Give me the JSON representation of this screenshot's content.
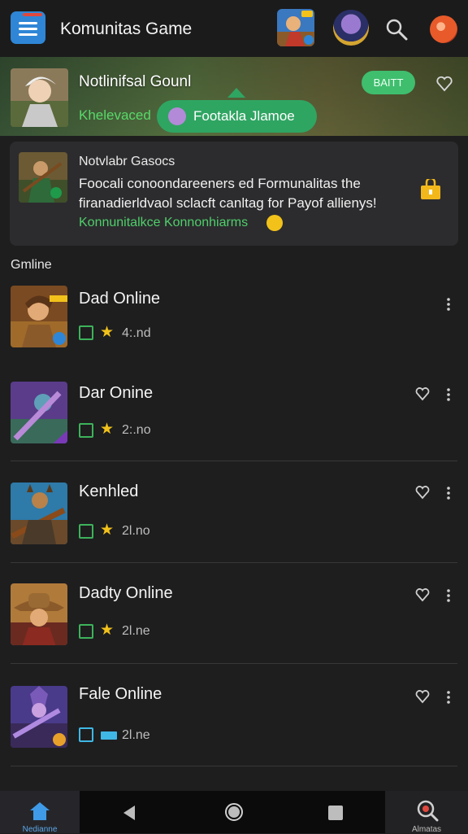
{
  "app_bar": {
    "title": "Komunitas Game"
  },
  "banner": {
    "title": "Notlinifsal Gounl",
    "subtitle": "Khelevaced",
    "pill_label": "Footakla Jlamoe",
    "button_label": "BAITT"
  },
  "feature": {
    "title": "Notvlabr Gasocs",
    "body": "Foocali conoondareeners ed Formunalitas the firanadierldvaol sclacft canltag for Payof allienys!",
    "link": "Konnunitalkce Konnonhiarms"
  },
  "section": {
    "label": "Gmline"
  },
  "rows": [
    {
      "name": "Dad Online",
      "stat": "4:.nd",
      "check_color": "green",
      "marker": "star",
      "has_heart": false
    },
    {
      "name": "Dar Onine",
      "stat": "2:.no",
      "check_color": "green",
      "marker": "star",
      "has_heart": true
    },
    {
      "name": "Kenhled",
      "stat": "2l.no",
      "check_color": "green",
      "marker": "star",
      "has_heart": true
    },
    {
      "name": "Dadty Online",
      "stat": "2l.ne",
      "check_color": "green",
      "marker": "star",
      "has_heart": true
    },
    {
      "name": "Fale Online",
      "stat": "2l.ne",
      "check_color": "blue",
      "marker": "flag",
      "has_heart": true
    }
  ],
  "bottom_nav": {
    "home_label": "Nedianne",
    "alerts_label": "Almatas"
  },
  "colors": {
    "accent_green": "#3fbe6e",
    "accent_blue": "#2f86d6",
    "star": "#f2c21b",
    "background": "#1e1e1f"
  },
  "icons": [
    "menu-icon",
    "search-icon",
    "heart-icon",
    "more-icon",
    "home-icon",
    "back-icon",
    "home-circle-icon",
    "recents-icon",
    "alerts-search-icon"
  ]
}
